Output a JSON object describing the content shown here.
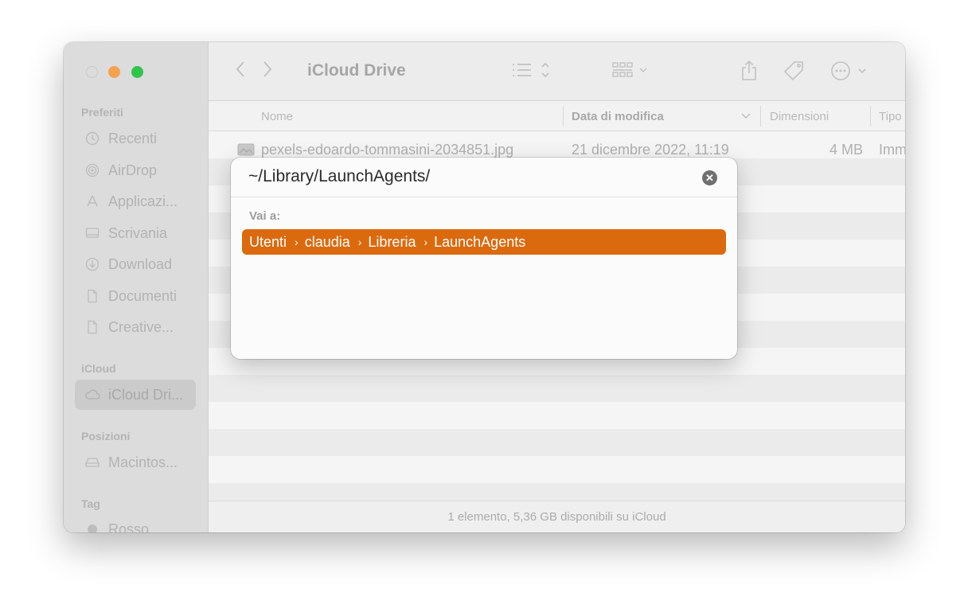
{
  "window": {
    "title": "iCloud Drive"
  },
  "sidebar": {
    "sections": [
      {
        "heading": "Preferiti",
        "items": [
          {
            "label": "Recenti",
            "icon": "clock-icon"
          },
          {
            "label": "AirDrop",
            "icon": "airdrop-icon"
          },
          {
            "label": "Applicazi...",
            "icon": "applications-icon"
          },
          {
            "label": "Scrivania",
            "icon": "desktop-icon"
          },
          {
            "label": "Download",
            "icon": "download-icon"
          },
          {
            "label": "Documenti",
            "icon": "document-icon"
          },
          {
            "label": "Creative...",
            "icon": "document-icon"
          }
        ]
      },
      {
        "heading": "iCloud",
        "items": [
          {
            "label": "iCloud Dri...",
            "icon": "cloud-icon",
            "selected": true
          }
        ]
      },
      {
        "heading": "Posizioni",
        "items": [
          {
            "label": "Macintos...",
            "icon": "disk-icon"
          }
        ]
      },
      {
        "heading": "Tag",
        "items": [
          {
            "label": "Rosso",
            "icon": "tag-dot-icon"
          }
        ]
      }
    ]
  },
  "columns": {
    "name": "Nome",
    "modified": "Data di modifica",
    "size": "Dimensioni",
    "kind": "Tipo"
  },
  "files": [
    {
      "name": "pexels-edoardo-tommasini-2034851.jpg",
      "modified": "21 dicembre 2022, 11:19",
      "size": "4 MB",
      "kind": "Imm"
    }
  ],
  "status": "1 elemento, 5,36 GB disponibili su iCloud",
  "goto_dialog": {
    "path_value": "~/Library/LaunchAgents/",
    "section_label": "Vai a:",
    "suggestion": [
      "Utenti",
      "claudia",
      "Libreria",
      "LaunchAgents"
    ],
    "accent_color": "#db6a0f"
  },
  "traffic_lights": {
    "close": "#dcdcdc",
    "minimize": "#f4a24e",
    "zoom": "#2ec54a"
  }
}
